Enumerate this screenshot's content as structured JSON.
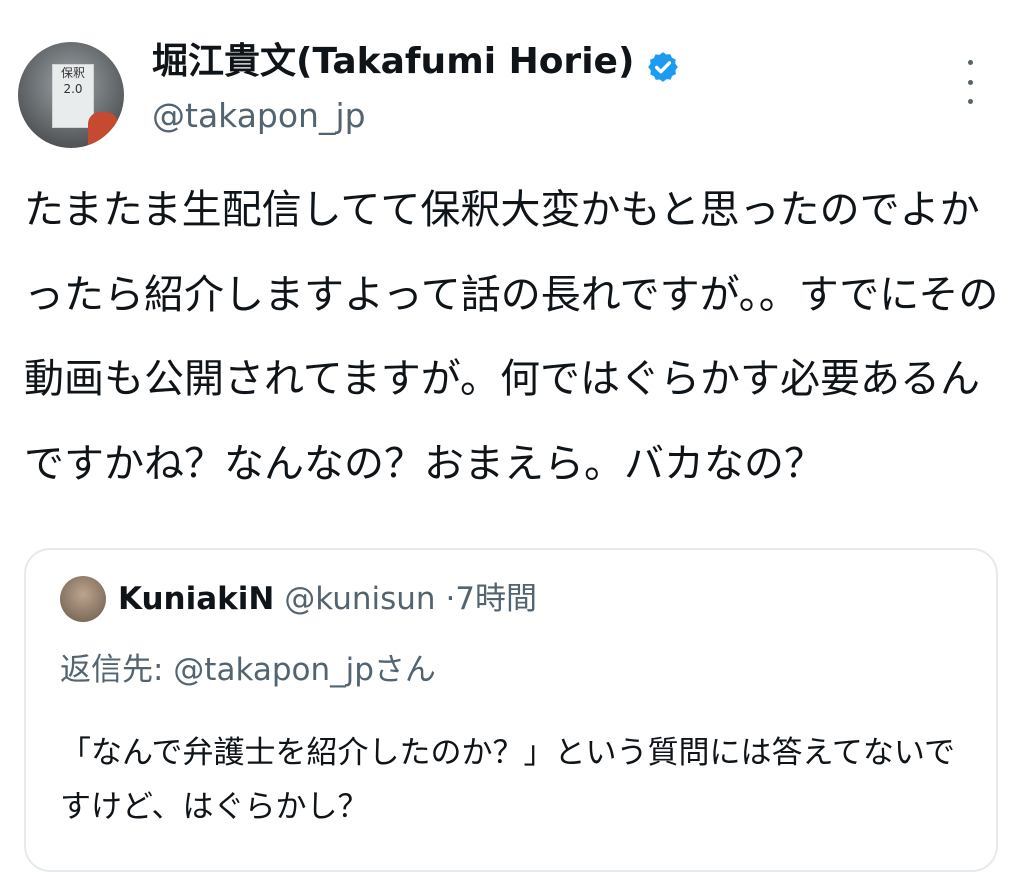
{
  "tweet": {
    "author_name": "堀江貴文(Takafumi Horie)",
    "handle": "@takapon_jp",
    "avatar_text": "保釈 2.0",
    "text": "たまたま生配信してて保釈大変かもと思ったのでよかったら紹介しますよって話の長れですが。。すでにその動画も公開されてますが。何ではぐらかす必要あるんですかね？なんなの？おまえら。バカなの？",
    "icons": {
      "verified": "verified-badge-icon",
      "more": "more-options-icon"
    }
  },
  "quoted_tweet": {
    "author_name": "KuniakiN",
    "handle": "@kunisun",
    "separator": "·",
    "time": "7時間",
    "reply_to": "返信先: @takapon_jpさん",
    "text": "「なんで弁護士を紹介したのか？」という質問には答えてないですけど、はぐらかし？"
  },
  "colors": {
    "verified": "#1d9bf0",
    "secondary_text": "#536471",
    "border": "#e7eaec"
  }
}
